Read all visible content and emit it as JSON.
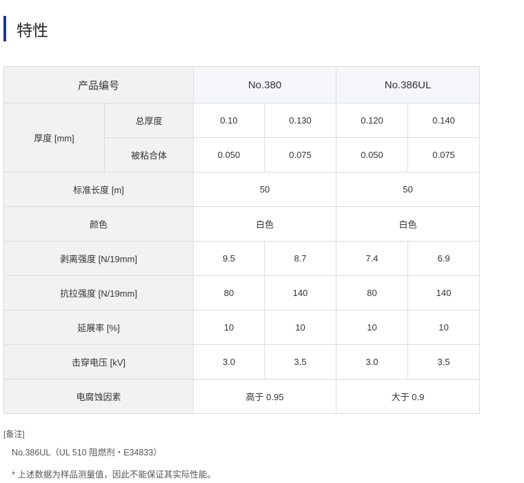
{
  "page": {
    "title": "特性"
  },
  "table": {
    "header": {
      "label": "产品编号",
      "col1": "No.380",
      "col2": "No.386UL"
    },
    "thickness": {
      "label": "厚度 [mm]",
      "total": {
        "label": "总厚度",
        "values": [
          "0.10",
          "0.130",
          "0.120",
          "0.140"
        ]
      },
      "adherend": {
        "label": "被粘合体",
        "values": [
          "0.050",
          "0.075",
          "0.050",
          "0.075"
        ]
      }
    },
    "length": {
      "label": "标准长度 [m]",
      "values": [
        "50",
        "50"
      ]
    },
    "color": {
      "label": "颜色",
      "values": [
        "白色",
        "白色"
      ]
    },
    "peel": {
      "label": "剥离强度 [N/19mm]",
      "values": [
        "9.5",
        "8.7",
        "7.4",
        "6.9"
      ]
    },
    "tensile": {
      "label": "抗拉强度 [N/19mm]",
      "values": [
        "80",
        "140",
        "80",
        "140"
      ]
    },
    "elongation": {
      "label": "延展率 [%]",
      "values": [
        "10",
        "10",
        "10",
        "10"
      ]
    },
    "breakdown": {
      "label": "击穿电压 [kV]",
      "values": [
        "3.0",
        "3.5",
        "3.0",
        "3.5"
      ]
    },
    "corrosion": {
      "label": "电腐蚀因素",
      "values": [
        "高于 0.95",
        "大于 0.9"
      ]
    }
  },
  "remarks": {
    "title": "[备注]",
    "line": "No.386UL（UL 510 阻燃剂・E34833）",
    "note": "* 上述数据为样品测量值，因此不能保证其实际性能。"
  }
}
